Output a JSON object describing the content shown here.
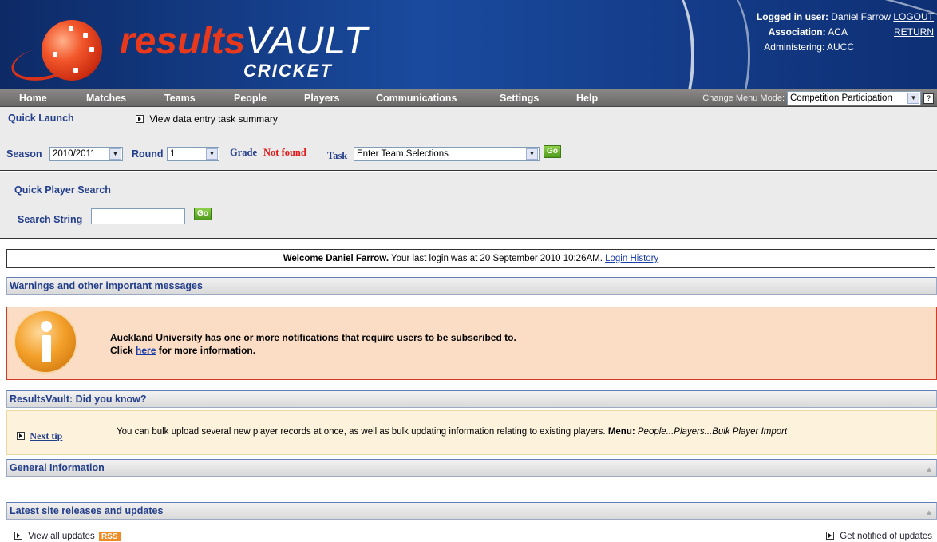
{
  "brand": {
    "name_red": "results",
    "name_white": "VAULT",
    "sub": "CRICKET"
  },
  "login": {
    "user_label": "Logged in user:",
    "user": "Daniel Farrow",
    "logout": "LOGOUT",
    "assoc_label": "Association:",
    "assoc": "ACA",
    "return": "RETURN",
    "administering": "Administering: AUCC"
  },
  "menu": {
    "items": [
      "Home",
      "Matches",
      "Teams",
      "People",
      "Players",
      "Communications",
      "Settings",
      "Help"
    ],
    "mode_label": "Change Menu Mode:",
    "mode_value": "Competition Participation",
    "help_glyph": "?"
  },
  "quick_launch": {
    "title": "Quick Launch",
    "task_summary_link": "View data entry task summary",
    "season_label": "Season",
    "season_value": "2010/2011",
    "round_label": "Round",
    "round_value": "1",
    "grade_label": "Grade",
    "grade_value": "Not found",
    "task_label": "Task",
    "task_value": "Enter Team Selections",
    "go_label": "Go"
  },
  "player_search": {
    "title": "Quick Player Search",
    "label": "Search String",
    "value": "",
    "go_label": "Go"
  },
  "welcome": {
    "greeting": "Welcome Daniel Farrow.",
    "last_login": "Your last login was at 20 September 2010 10:26AM.",
    "history_link": "Login History"
  },
  "warnings": {
    "title": "Warnings and other important messages",
    "line1": "Auckland University has one or more notifications that require users to be subscribed to.",
    "line2_prefix": "Click",
    "line2_link": "here",
    "line2_suffix": "for more information."
  },
  "did_you_know": {
    "title": "ResultsVault: Did you know?",
    "next_tip": "Next tip",
    "tip_text": "You can bulk upload several new player records at once, as well as bulk updating information relating to existing players.",
    "menu_label": "Menu:",
    "menu_path": "People...Players...Bulk Player Import"
  },
  "general_info": {
    "title": "General Information"
  },
  "releases": {
    "title": "Latest site releases and updates",
    "view_all": "View all updates",
    "rss": "RSS",
    "notify": "Get notified of updates"
  }
}
